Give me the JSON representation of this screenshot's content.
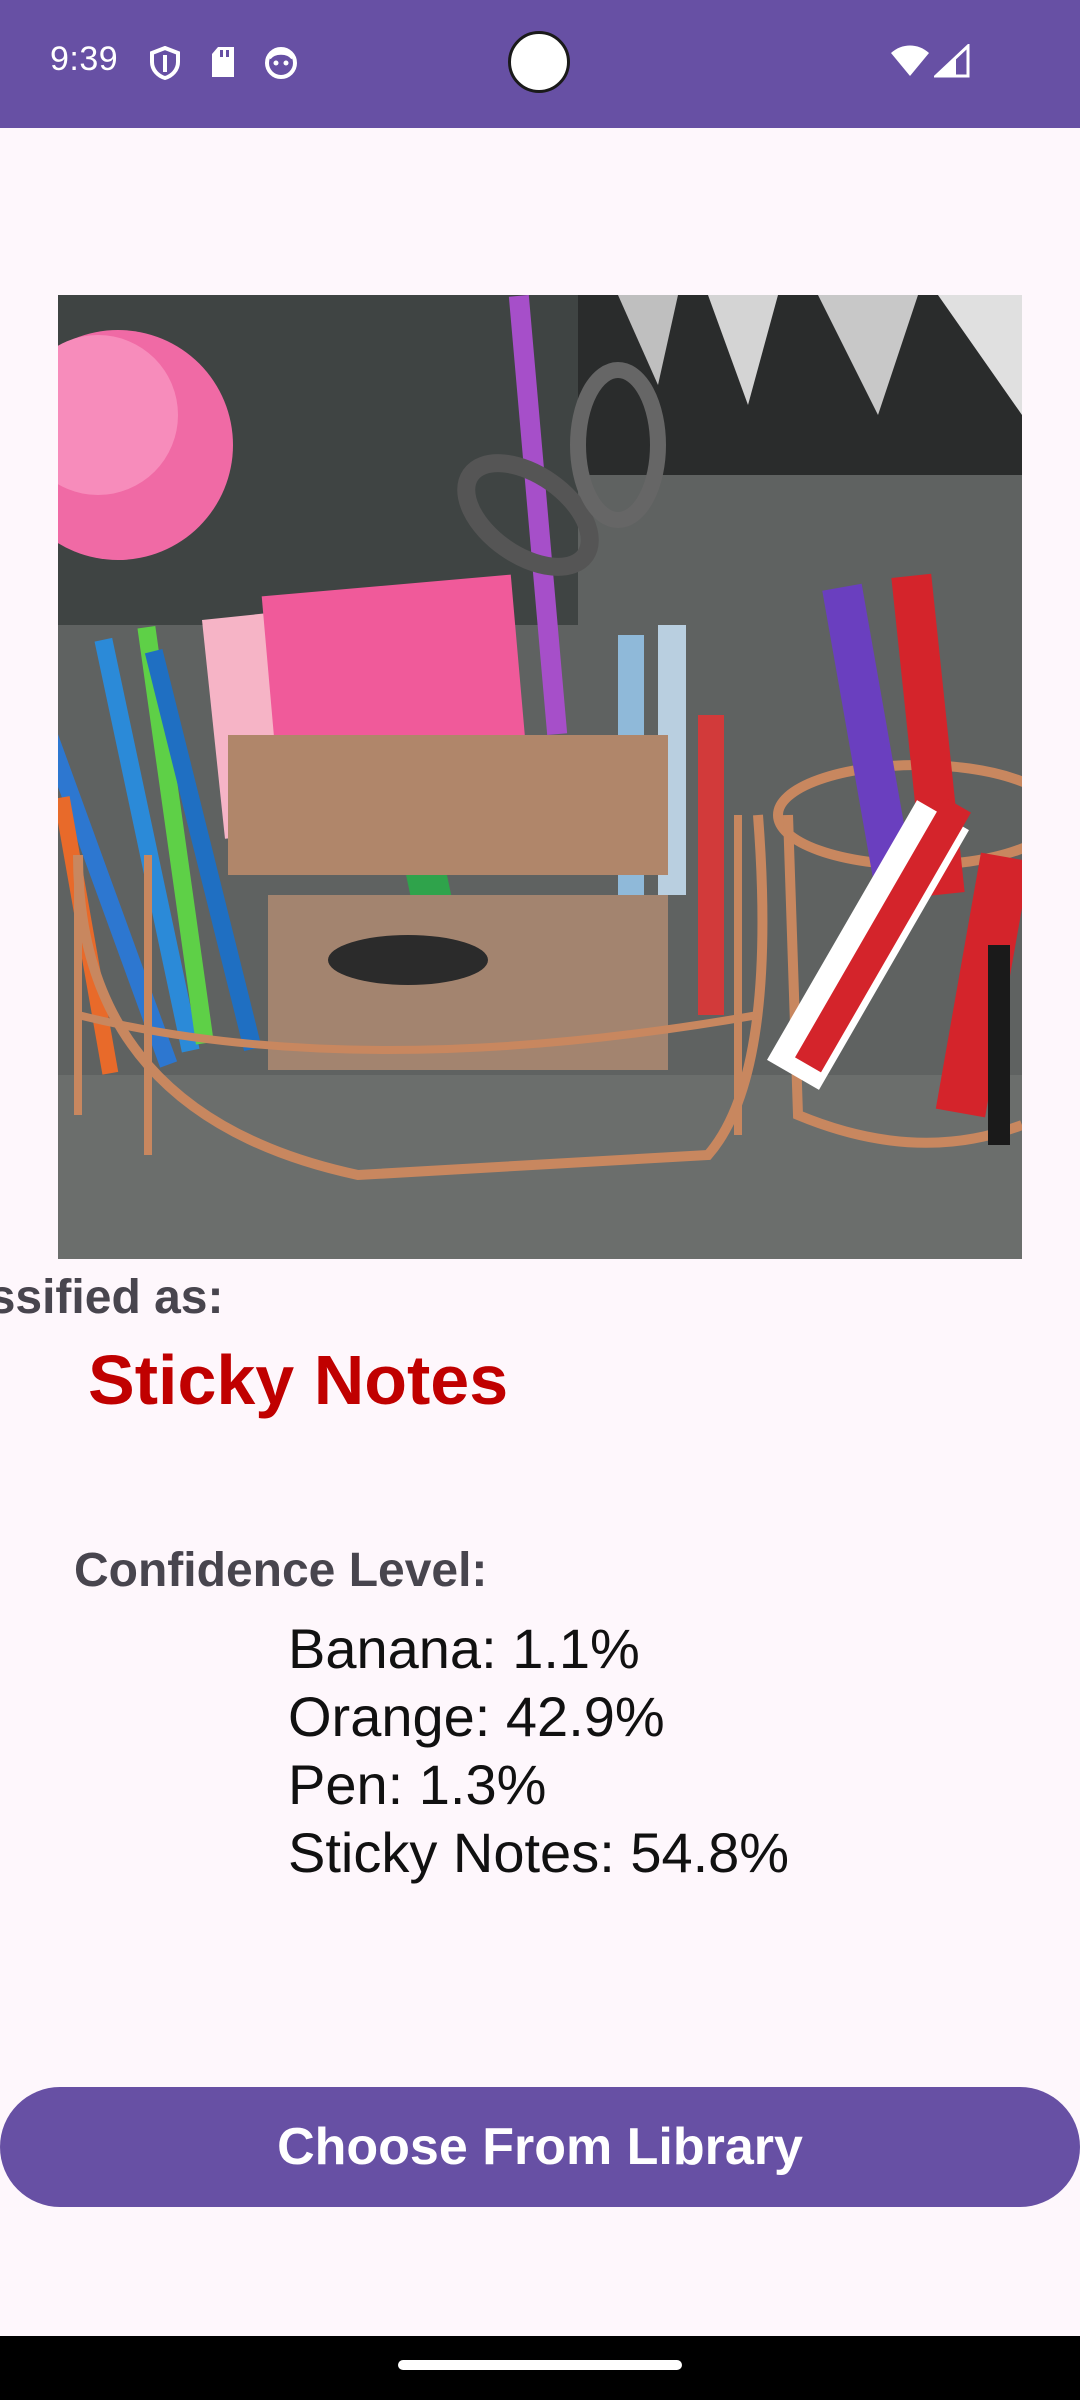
{
  "status_bar": {
    "time": "9:39",
    "icons": [
      "shield-icon",
      "sd-card-icon",
      "face-icon",
      "wifi-icon",
      "signal-icon"
    ],
    "color": "#6750a4"
  },
  "image": {
    "description_icon": "desk-organizer-photo"
  },
  "classification": {
    "label": "assified as:",
    "result": "Sticky Notes",
    "result_color": "#c00000"
  },
  "confidence": {
    "label": "Confidence Level:",
    "items": [
      "Banana: 1.1%",
      "Orange: 42.9%",
      "Pen: 1.3%",
      "Sticky Notes: 54.8%"
    ]
  },
  "button": {
    "label": "Choose From Library",
    "color": "#6750a4"
  }
}
